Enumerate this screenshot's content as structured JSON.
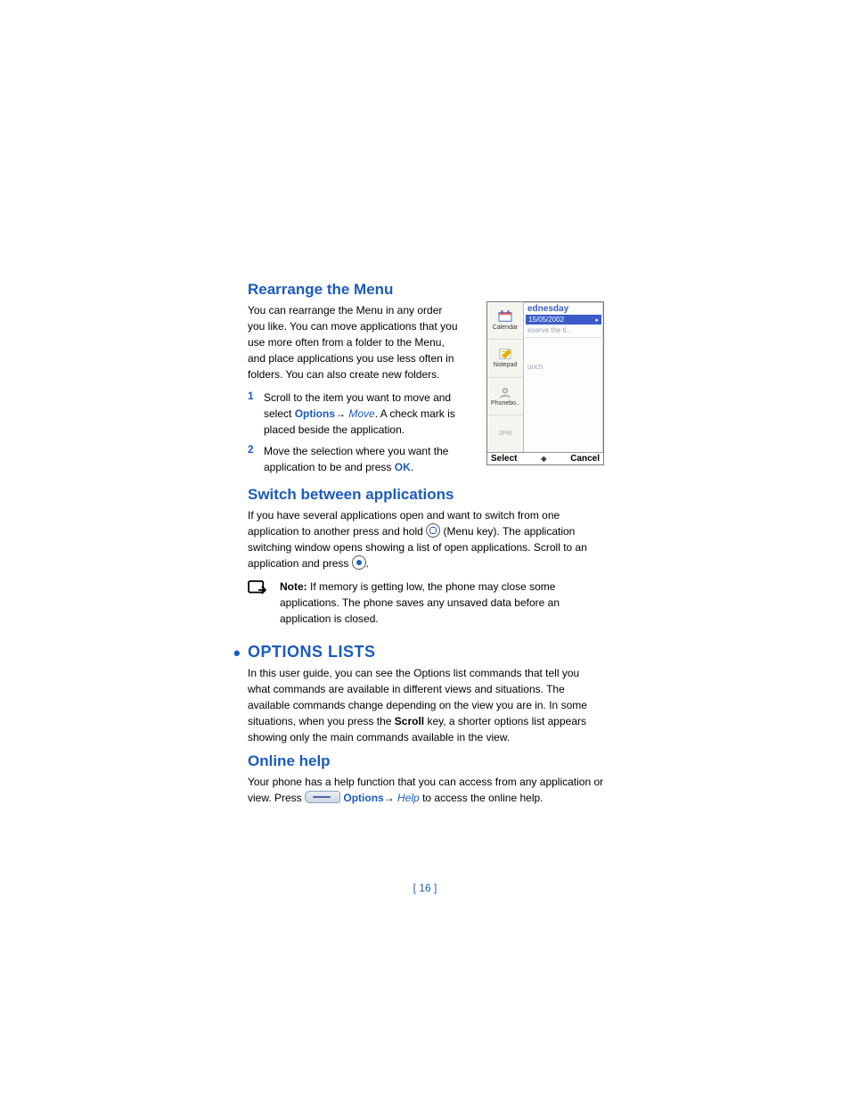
{
  "headings": {
    "rearrange": "Rearrange the Menu",
    "switch": "Switch between applications",
    "options_lists": "OPTIONS LISTS",
    "online_help": "Online help"
  },
  "rearrange": {
    "intro": "You can rearrange the Menu in any order you like. You can move applications that you use more often from a folder to the Menu, and place applications you use less often in folders. You can also create new folders.",
    "step1": {
      "num": "1",
      "pre": "Scroll to the item you want to move and select ",
      "options": "Options",
      "arrow": "→ ",
      "move": "Move",
      "post": ". A check mark is placed beside the application."
    },
    "step2": {
      "num": "2",
      "pre": "Move the selection where you want the application to be and press ",
      "ok": "OK",
      "post": "."
    }
  },
  "switch": {
    "p1a": "If you have several applications open and want to switch from one application to another press and hold ",
    "p1b": " (Menu key). The application switching window opens showing a list of open applications. Scroll to an application and press ",
    "p1c": ".",
    "note_label": "Note:",
    "note_body": " If memory is getting low, the phone may close some applications. The phone saves any unsaved data before an application is closed."
  },
  "options_lists": {
    "p_a": "In this user guide, you can see the Options list commands that tell you what commands are available in different views and situations. The available commands change depending on the view you are in. In some situations, when you press the ",
    "scroll": "Scroll",
    "p_b": " key, a shorter options list appears showing only the main commands available in the view."
  },
  "online_help": {
    "p_a": "Your phone has a help function that you can access from any application or view. Press ",
    "options": "Options",
    "arrow": "→ ",
    "help": "Help",
    "p_b": " to access the online help."
  },
  "phone_shot": {
    "side": {
      "calendar": "Calendar",
      "notepad": "Notepad",
      "phonebook": "Phonebo..",
      "time": "2PM"
    },
    "day": "ednesday",
    "date": "15/05/2002",
    "entry": "eserve the ti..",
    "lunch": "unch",
    "select": "Select",
    "cancel": "Cancel",
    "mid": "◆"
  },
  "page_number": "[ 16 ]"
}
